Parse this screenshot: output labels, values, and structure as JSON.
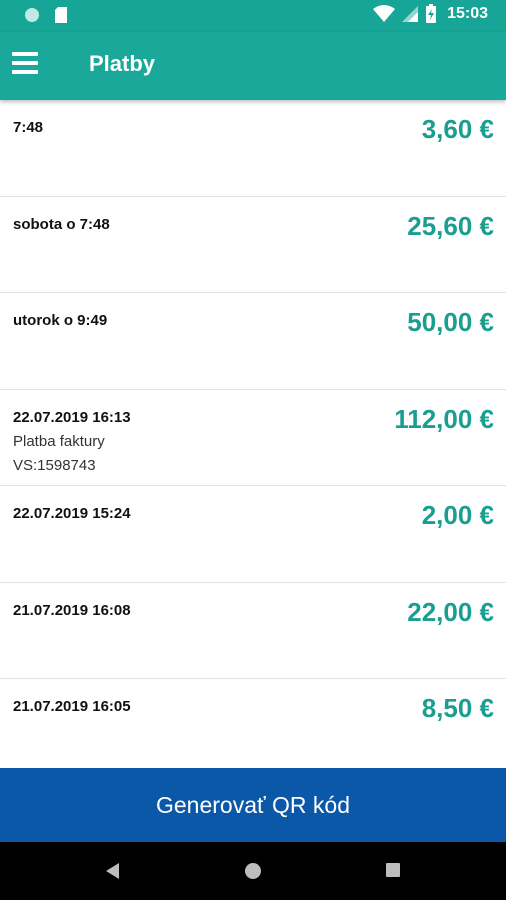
{
  "status_bar": {
    "time": "15:03",
    "icons": [
      "notification-dot-icon",
      "sd-card-icon",
      "wifi-icon",
      "signal-icon",
      "battery-icon"
    ]
  },
  "app_bar": {
    "title": "Platby",
    "menu_icon": "hamburger-menu-icon",
    "background": "#19a899"
  },
  "payments": [
    {
      "date": "7:48",
      "lines": [],
      "amount": "3,60 €"
    },
    {
      "date": "sobota o 7:48",
      "lines": [],
      "amount": "25,60 €"
    },
    {
      "date": "utorok o 9:49",
      "lines": [],
      "amount": "50,00 €"
    },
    {
      "date": "22.07.2019 16:13",
      "lines": [
        "Platba faktury",
        "VS:1598743"
      ],
      "amount": "112,00 €"
    },
    {
      "date": "22.07.2019 15:24",
      "lines": [],
      "amount": "2,00 €"
    },
    {
      "date": "21.07.2019 16:08",
      "lines": [],
      "amount": "22,00 €"
    },
    {
      "date": "21.07.2019 16:05",
      "lines": [],
      "amount": "8,50 €"
    }
  ],
  "primary_action": {
    "label": "Generovať QR kód",
    "background": "#0b58a8"
  },
  "nav_bar": {
    "buttons": [
      "back-icon",
      "home-icon",
      "recents-icon"
    ]
  },
  "colors": {
    "amount": "#1a9e8f",
    "status_bar": "#16a596"
  }
}
